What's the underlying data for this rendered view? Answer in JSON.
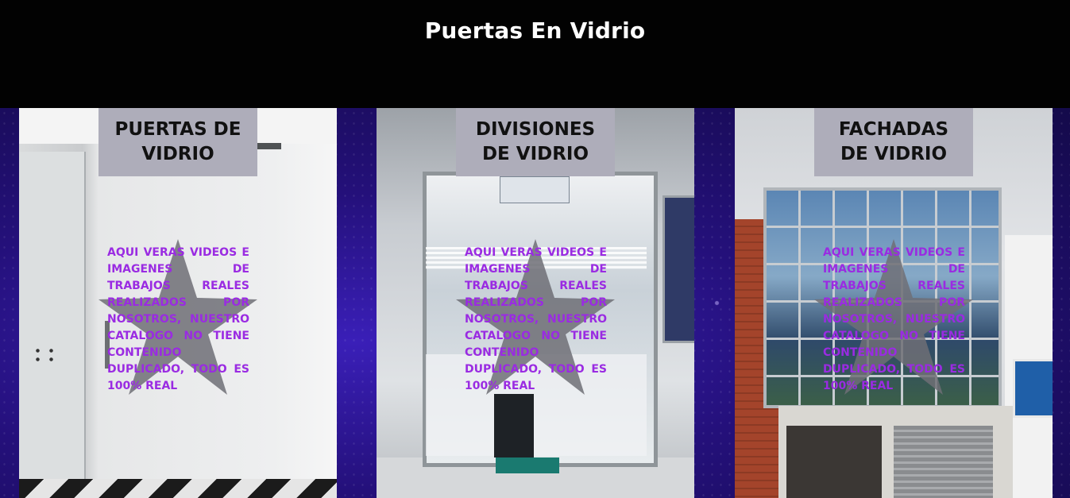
{
  "header": {
    "title": "Puertas En Vidrio"
  },
  "cards": [
    {
      "title": "PUERTAS DE VIDRIO",
      "description": "AQUI VERAS VIDEOS E IMAGENES DE TRABAJOS REALES REALIZADOS POR NOSOTROS, NUESTRO CATALOGO NO TIENE CONTENIDO DUPLICADO, TODO ES 100% REAL"
    },
    {
      "title": "DIVISIONES DE VIDRIO",
      "description": "AQUI VERAS VIDEOS E IMAGENES DE TRABAJOS REALES REALIZADOS POR NOSOTROS, NUESTRO CATALOGO NO TIENE CONTENIDO DUPLICADO, TODO ES 100% REAL"
    },
    {
      "title": "FACHADAS DE VIDRIO",
      "description": "AQUI VERAS VIDEOS E IMAGENES DE TRABAJOS REALES REALIZADOS POR NOSOTROS, NUESTRO CATALOGO NO TIENE CONTENIDO DUPLICADO, TODO ES 100% REAL"
    }
  ],
  "colors": {
    "header_bg": "#020202",
    "title_box_bg": "#aeadba",
    "description_text": "#9a2be2",
    "star_fill": "#6f6f76"
  },
  "icons": {
    "card_overlay": "star-icon"
  }
}
